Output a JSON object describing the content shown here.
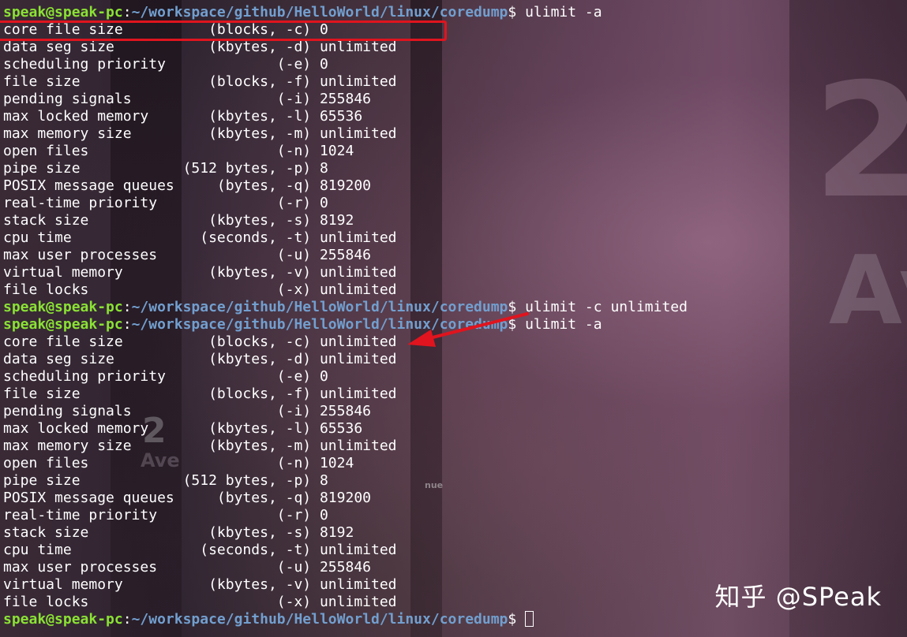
{
  "terminal": {
    "prompt": {
      "user_host": "speak@speak-pc",
      "separator": ":",
      "path": "~/workspace/github/HelloWorld/linux/coredump",
      "symbol": "$ "
    },
    "cmd1": "ulimit -a",
    "output1": [
      "core file size          (blocks, -c) 0",
      "data seg size           (kbytes, -d) unlimited",
      "scheduling priority             (-e) 0",
      "file size               (blocks, -f) unlimited",
      "pending signals                 (-i) 255846",
      "max locked memory       (kbytes, -l) 65536",
      "max memory size         (kbytes, -m) unlimited",
      "open files                      (-n) 1024",
      "pipe size            (512 bytes, -p) 8",
      "POSIX message queues     (bytes, -q) 819200",
      "real-time priority              (-r) 0",
      "stack size              (kbytes, -s) 8192",
      "cpu time               (seconds, -t) unlimited",
      "max user processes              (-u) 255846",
      "virtual memory          (kbytes, -v) unlimited",
      "file locks                      (-x) unlimited"
    ],
    "cmd2": "ulimit -c unlimited",
    "cmd3": "ulimit -a",
    "output2": [
      "core file size          (blocks, -c) unlimited",
      "data seg size           (kbytes, -d) unlimited",
      "scheduling priority             (-e) 0",
      "file size               (blocks, -f) unlimited",
      "pending signals                 (-i) 255846",
      "max locked memory       (kbytes, -l) 65536",
      "max memory size         (kbytes, -m) unlimited",
      "open files                      (-n) 1024",
      "pipe size            (512 bytes, -p) 8",
      "POSIX message queues     (bytes, -q) 819200",
      "real-time priority              (-r) 0",
      "stack size              (kbytes, -s) 8192",
      "cpu time               (seconds, -t) unlimited",
      "max user processes              (-u) 255846",
      "virtual memory          (kbytes, -v) unlimited",
      "file locks                      (-x) unlimited"
    ]
  },
  "background": {
    "numeral_large": "2",
    "numeral_small": "2",
    "sign_large": "Av",
    "sign_small": "Ave",
    "sign_tiny": "nue"
  },
  "watermark": "知乎 @SPeak",
  "colors": {
    "prompt_user": "#8ae234",
    "prompt_path": "#729fcf",
    "annotation": "#e0141e",
    "text": "#ffffff"
  },
  "icons": {
    "cursor": "block-cursor-icon",
    "arrow": "red-arrow-icon"
  }
}
